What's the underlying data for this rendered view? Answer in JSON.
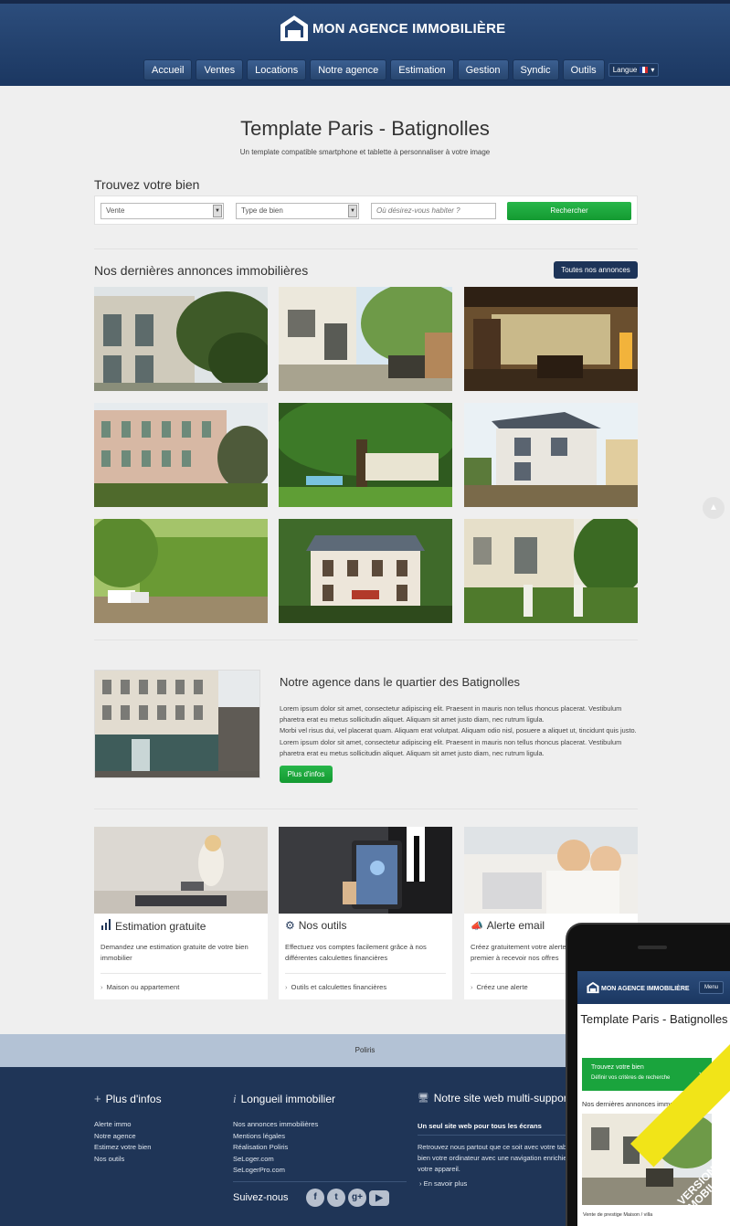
{
  "header": {
    "brand": "MON AGENCE IMMOBILIÈRE",
    "nav": [
      "Accueil",
      "Ventes",
      "Locations",
      "Notre agence",
      "Estimation",
      "Gestion",
      "Syndic",
      "Outils"
    ],
    "language_label": "Langue"
  },
  "hero": {
    "title": "Template Paris - Batignolles",
    "subtitle": "Un template compatible smartphone et tablette à personnaliser à votre image"
  },
  "search": {
    "title": "Trouvez votre bien",
    "transaction_value": "Vente",
    "type_value": "Type de bien",
    "location_placeholder": "Où désirez-vous habiter ?",
    "button": "Rechercher"
  },
  "listings": {
    "title": "Nos dernières annonces immobilières",
    "all_button": "Toutes nos annonces"
  },
  "agency": {
    "title": "Notre agence dans le quartier des Batignolles",
    "paragraph1": "Lorem ipsum dolor sit amet, consectetur adipiscing elit. Praesent in mauris non tellus rhoncus placerat. Vestibulum pharetra erat eu metus sollicitudin aliquet. Aliquam sit amet justo diam, nec rutrum ligula.",
    "paragraph2": "Morbi vel risus dui, vel placerat quam. Aliquam erat volutpat. Aliquam odio nisl, posuere a aliquet ut, tincidunt quis justo. Lorem ipsum dolor sit amet, consectetur adipiscing elit. Praesent in mauris non tellus rhoncus placerat. Vestibulum pharetra erat eu metus sollicitudin aliquet. Aliquam sit amet justo diam, nec rutrum ligula.",
    "button": "Plus d'infos"
  },
  "services": [
    {
      "title": "Estimation gratuite",
      "text": "Demandez une estimation gratuite de votre bien immobilier",
      "link": "Maison ou appartement",
      "icon": "bar-chart-icon"
    },
    {
      "title": "Nos outils",
      "text": "Effectuez vos comptes facilement grâce à nos différentes calculettes financières",
      "link": "Outils et calculettes financières",
      "icon": "gear-icon"
    },
    {
      "title": "Alerte email",
      "text": "Créez gratuitement votre alerte email et soyez le premier à recevoir nos offres",
      "link": "Créez une alerte",
      "icon": "bullhorn-icon"
    }
  ],
  "footer": {
    "band": "Poliris",
    "col1_title": "Plus d'infos",
    "col1_links": [
      "Alerte immo",
      "Notre agence",
      "Estimez votre bien",
      "Nos outils"
    ],
    "col2_title": "Longueil immobilier",
    "col2_links": [
      "Nos annonces immobilières",
      "Mentions légales",
      "Réalisation Poliris",
      "SeLoger.com",
      "SeLogerPro.com"
    ],
    "follow": "Suivez-nous",
    "col3_title": "Notre site web multi-supports",
    "col3_sub": "Un seul site web pour tous les écrans",
    "col3_text": "Retrouvez nous partout que ce soit avec votre tablette ou bien votre ordinateur avec une navigation enrichie pour votre appareil.",
    "col3_link": "En savoir plus"
  },
  "mobile": {
    "brand": "MON AGENCE IMMOBILIÈRE",
    "menu": "Menu",
    "title": "Template Paris - Batignolles",
    "search_title": "Trouvez votre bien",
    "search_sub": "Définir vos critères de recherche",
    "latest": "Nos dernières annonces immobilières",
    "caption": "Vente de prestige Maison / villa",
    "ribbon": "VERSION MOBILE"
  },
  "colors": {
    "navy": "#1f3557",
    "green": "#1aa43d",
    "band": "#b3c2d5"
  }
}
